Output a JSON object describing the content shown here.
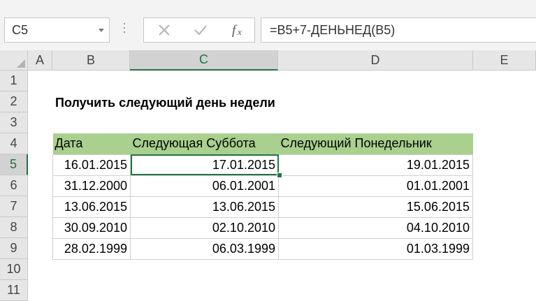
{
  "formula_bar": {
    "name_box": "C5",
    "formula": "=B5+7-ДЕНЬНЕД(B5)"
  },
  "columns": [
    "A",
    "B",
    "C",
    "D",
    "E"
  ],
  "active_column": "C",
  "rows": [
    "1",
    "2",
    "3",
    "4",
    "5",
    "6",
    "7",
    "8",
    "9",
    "10",
    "11"
  ],
  "active_row": "5",
  "sheet": {
    "title": "Получить следующий день недели",
    "headers": [
      "Дата",
      "Следующая Суббота",
      "Следующий Понедельник"
    ],
    "rows": [
      [
        "16.01.2015",
        "17.01.2015",
        "19.01.2015"
      ],
      [
        "31.12.2000",
        "06.01.2001",
        "01.01.2001"
      ],
      [
        "13.06.2015",
        "13.06.2015",
        "15.06.2015"
      ],
      [
        "30.09.2010",
        "02.10.2010",
        "04.10.2010"
      ],
      [
        "28.02.1999",
        "06.03.1999",
        "01.03.1999"
      ]
    ]
  },
  "colors": {
    "accent": "#217346",
    "header_fill": "#a9d08e"
  },
  "icons": [
    "cancel-icon",
    "enter-icon",
    "function-icon",
    "dropdown-arrow-icon"
  ]
}
